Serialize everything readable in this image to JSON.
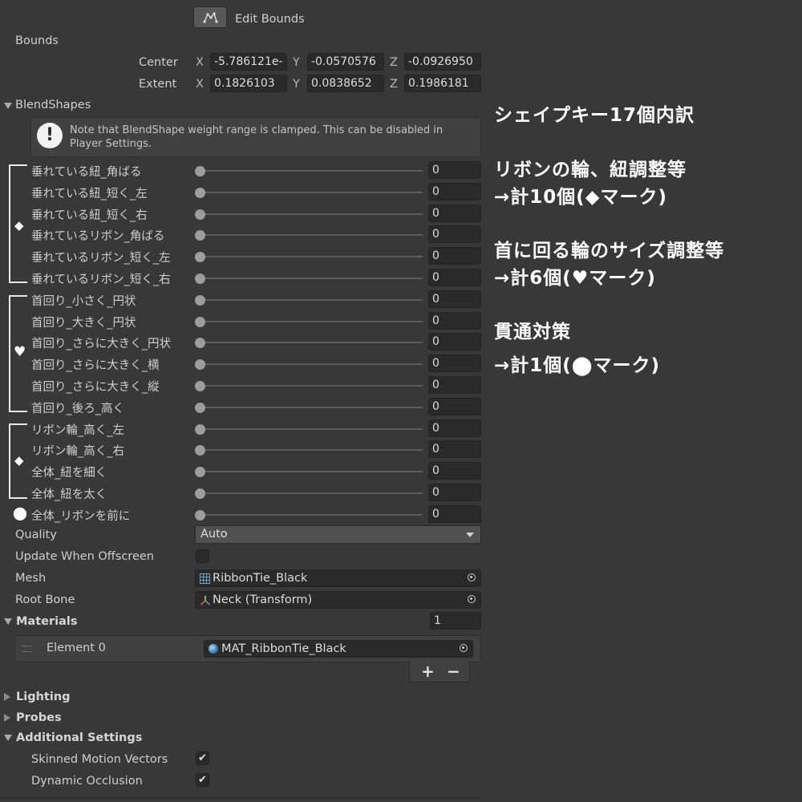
{
  "edit_bounds": {
    "label": "Edit Bounds"
  },
  "bounds": {
    "label": "Bounds",
    "center_label": "Center",
    "extent_label": "Extent",
    "axes": [
      "X",
      "Y",
      "Z"
    ],
    "center": [
      "-5.786121e-",
      "-0.0570576",
      "-0.0926950"
    ],
    "extent": [
      "0.1826103",
      "0.0838652",
      "0.1986181"
    ]
  },
  "blendshapes": {
    "label": "BlendShapes",
    "note": "Note that BlendShape weight range is clamped. This can be disabled in Player Settings.",
    "items": [
      {
        "label": "垂れている紐_角ばる",
        "value": "0",
        "weight": 0
      },
      {
        "label": "垂れている紐_短く_左",
        "value": "0",
        "weight": 0
      },
      {
        "label": "垂れている紐_短く_右",
        "value": "0",
        "weight": 0
      },
      {
        "label": "垂れているリボン_角ばる",
        "value": "0",
        "weight": 0
      },
      {
        "label": "垂れているリボン_短く_左",
        "value": "0",
        "weight": 0
      },
      {
        "label": "垂れているリボン_短く_右",
        "value": "0",
        "weight": 0
      },
      {
        "label": "首回り_小さく_円状",
        "value": "0",
        "weight": 0
      },
      {
        "label": "首回り_大きく_円状",
        "value": "0",
        "weight": 0
      },
      {
        "label": "首回り_さらに大きく_円状",
        "value": "0",
        "weight": 0
      },
      {
        "label": "首回り_さらに大きく_横",
        "value": "0",
        "weight": 0
      },
      {
        "label": "首回り_さらに大きく_縦",
        "value": "0",
        "weight": 0
      },
      {
        "label": "首回り_後ろ_高く",
        "value": "0",
        "weight": 0
      },
      {
        "label": "リボン輪_高く_左",
        "value": "0",
        "weight": 0
      },
      {
        "label": "リボン輪_高く_右",
        "value": "0",
        "weight": 0
      },
      {
        "label": "全体_紐を細く",
        "value": "0",
        "weight": 0
      },
      {
        "label": "全体_紐を太く",
        "value": "0",
        "weight": 0
      },
      {
        "label": "全体_リボンを前に",
        "value": "0",
        "weight": 0
      }
    ],
    "group_symbols": [
      "◆",
      "♥",
      "◆",
      "⬤"
    ]
  },
  "quality": {
    "label": "Quality",
    "value": "Auto"
  },
  "update_offscreen": {
    "label": "Update When Offscreen",
    "checked": false
  },
  "mesh": {
    "label": "Mesh",
    "value": "RibbonTie_Black"
  },
  "root_bone": {
    "label": "Root Bone",
    "value": "Neck (Transform)"
  },
  "materials": {
    "label": "Materials",
    "count": "1",
    "element_label": "Element 0",
    "element_value": "MAT_RibbonTie_Black",
    "add": "+",
    "remove": "−"
  },
  "sections": {
    "lighting": "Lighting",
    "probes": "Probes",
    "additional": "Additional Settings"
  },
  "additional": {
    "skinned_motion_vectors": {
      "label": "Skinned Motion Vectors",
      "checked": true
    },
    "dynamic_occlusion": {
      "label": "Dynamic Occlusion",
      "checked": true
    }
  },
  "annotation": {
    "title": "シェイプキー17個内訳",
    "g1_desc": "リボンの輪、紐調整等",
    "g1_count": "→計10個(◆マーク)",
    "g2_desc": "首に回る輪のサイズ調整等",
    "g2_count": "→計6個(♥マーク)",
    "g3_desc": "貫通対策",
    "g3_count": "→計1個(⬤マーク)"
  },
  "colors": {
    "background": "#383838",
    "field": "#2a2a2a",
    "annotation_text": "#ffffff"
  }
}
